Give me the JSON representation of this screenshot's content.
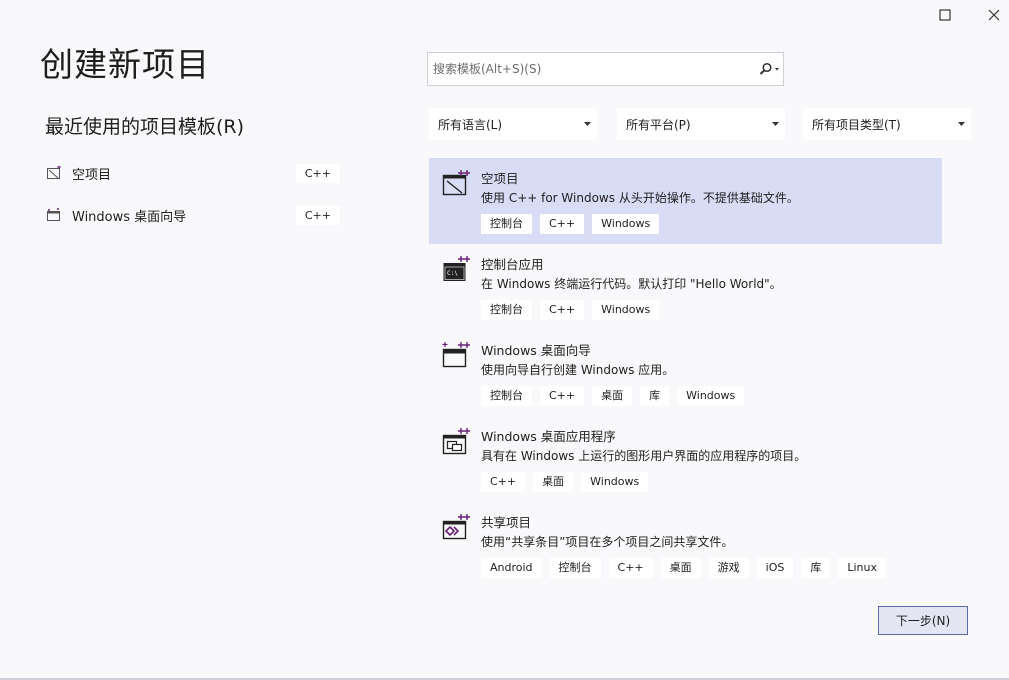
{
  "window": {
    "maximize_icon": "maximize-icon",
    "close_icon": "close-icon"
  },
  "page_title": "创建新项目",
  "recent": {
    "title": "最近使用的项目模板(R)",
    "items": [
      {
        "label": "空项目",
        "tag": "C++",
        "icon": "empty-project-icon"
      },
      {
        "label": "Windows 桌面向导",
        "tag": "C++",
        "icon": "desktop-wizard-icon"
      }
    ]
  },
  "search": {
    "placeholder": "搜索模板(Alt+S)(S)",
    "icon": "search-icon"
  },
  "filters": {
    "language": "所有语言(L)",
    "platform": "所有平台(P)",
    "project_type": "所有项目类型(T)"
  },
  "templates": [
    {
      "name": "空项目",
      "description": "使用 C++ for Windows 从头开始操作。不提供基础文件。",
      "tags": [
        "控制台",
        "C++",
        "Windows"
      ],
      "icon": "empty-project-icon",
      "selected": true
    },
    {
      "name": "控制台应用",
      "description": "在 Windows 终端运行代码。默认打印 \"Hello World\"。",
      "tags": [
        "控制台",
        "C++",
        "Windows"
      ],
      "icon": "console-app-icon",
      "selected": false
    },
    {
      "name": "Windows 桌面向导",
      "description": "使用向导自行创建 Windows 应用。",
      "tags": [
        "控制台",
        "C++",
        "桌面",
        "库",
        "Windows"
      ],
      "icon": "desktop-wizard-icon",
      "selected": false
    },
    {
      "name": "Windows 桌面应用程序",
      "description": "具有在 Windows 上运行的图形用户界面的应用程序的项目。",
      "tags": [
        "C++",
        "桌面",
        "Windows"
      ],
      "icon": "desktop-app-icon",
      "selected": false
    },
    {
      "name": "共享项目",
      "description": "使用“共享条目”项目在多个项目之间共享文件。",
      "tags": [
        "Android",
        "控制台",
        "C++",
        "桌面",
        "游戏",
        "iOS",
        "库",
        "Linux"
      ],
      "icon": "shared-project-icon",
      "selected": false
    }
  ],
  "next_button": "下一步(N)",
  "colors": {
    "background": "#f9f9fb",
    "selected": "#d9dcf5",
    "accent": "#68217a",
    "button_border": "#5a6aa8"
  }
}
